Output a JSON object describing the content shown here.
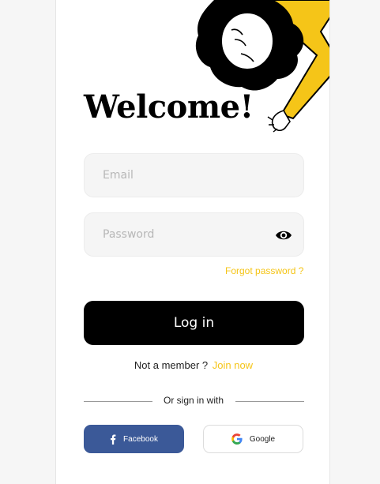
{
  "header": {
    "title": "Welcome!"
  },
  "form": {
    "email": {
      "placeholder": "Email",
      "value": ""
    },
    "password": {
      "placeholder": "Password",
      "value": ""
    },
    "forgot_label": "Forgot password ?",
    "login_label": "Log in"
  },
  "signup": {
    "prompt": "Not a member ?",
    "join_label": "Join now"
  },
  "social": {
    "divider_text": "Or sign in with",
    "facebook_label": "Facebook",
    "google_label": "Google"
  },
  "colors": {
    "accent": "#f5c518",
    "facebook": "#3b5998",
    "primary": "#000000",
    "field_bg": "#f5f5f5"
  },
  "icons": {
    "illustration": "person-illustration",
    "password_toggle": "eye-icon",
    "facebook": "facebook-icon",
    "google": "google-icon"
  }
}
